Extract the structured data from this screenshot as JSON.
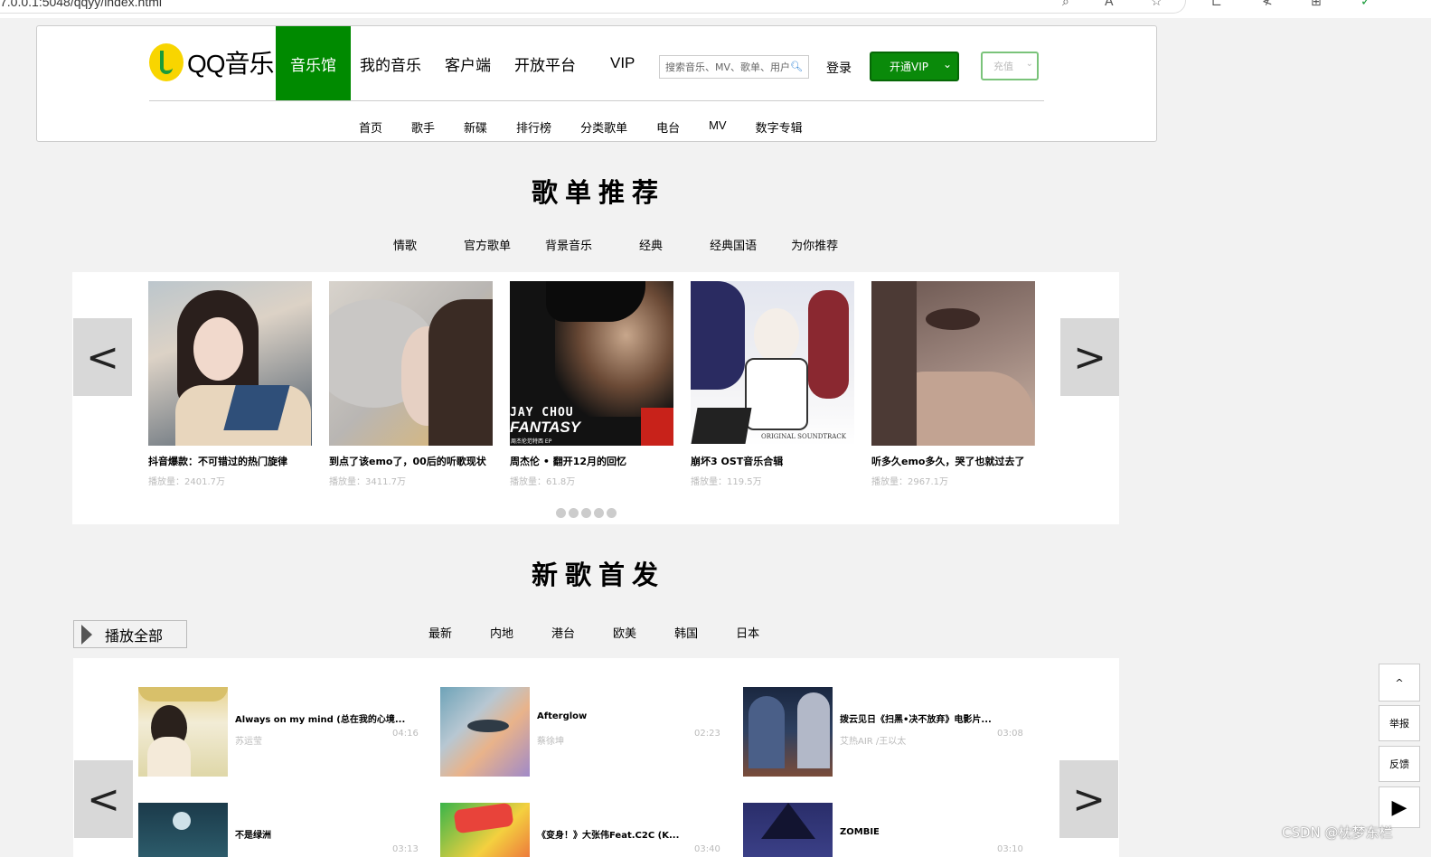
{
  "browser": {
    "url": "7.0.0.1:5048/qqyy/index.html"
  },
  "logo": {
    "text": "QQ音乐"
  },
  "topnav": [
    "音乐馆",
    "我的音乐",
    "客户端",
    "开放平台",
    "VIP"
  ],
  "search": {
    "placeholder": "搜索音乐、MV、歌单、用户"
  },
  "header": {
    "login": "登录",
    "vip_button": "开通VIP",
    "recharge": "充值"
  },
  "subnav": [
    "首页",
    "歌手",
    "新碟",
    "排行榜",
    "分类歌单",
    "电台",
    "MV",
    "数字专辑"
  ],
  "playlists": {
    "title": "歌单推荐",
    "tabs": [
      "情歌",
      "官方歌单",
      "背景音乐",
      "经典",
      "经典国语",
      "为你推荐"
    ],
    "prev": "<",
    "next": ">",
    "items": [
      {
        "name": "抖音爆款：不可错过的热门旋律",
        "plays": "播放量：2401.7万"
      },
      {
        "name": "到点了该emo了，00后的听歌现状",
        "plays": "播放量：3411.7万"
      },
      {
        "name": "周杰伦 • 翻开12月的回忆",
        "plays": "播放量：61.8万"
      },
      {
        "name": "崩坏3 OST音乐合辑",
        "plays": "播放量：119.5万"
      },
      {
        "name": "听多久emo多久，哭了也就过去了",
        "plays": "播放量：2967.1万"
      }
    ],
    "cover_texts": {
      "jay_line1": "JAY CHOU",
      "jay_line2": "FANTASY",
      "jay_sub": "周杰伦范特西 EP",
      "honkai": "ORIGINAL SOUNDTRACK"
    }
  },
  "newsongs": {
    "title": "新歌首发",
    "play_all": "播放全部",
    "tabs": [
      "最新",
      "内地",
      "港台",
      "欧美",
      "韩国",
      "日本"
    ],
    "prev": "<",
    "next": ">",
    "songs": [
      {
        "title": "Always on my mind (总在我的心境...",
        "artist": "苏运莹",
        "duration": "04:16"
      },
      {
        "title": "Afterglow",
        "artist": "蔡徐坤",
        "duration": "02:23"
      },
      {
        "title": "拨云见日《扫黑•决不放弃》电影片...",
        "artist": "艾热AIR /王以太",
        "duration": "03:08"
      },
      {
        "title": "不是绿洲",
        "artist": "",
        "duration": "03:13"
      },
      {
        "title": "《变身！》大张伟Feat.C2C (K...",
        "artist": "",
        "duration": "03:40"
      },
      {
        "title": "ZOMBIE",
        "artist": "",
        "duration": "03:10"
      }
    ]
  },
  "floating": {
    "top": "^",
    "report": "举报",
    "feedback": "反馈"
  },
  "watermark": "CSDN @枕梦东栏"
}
